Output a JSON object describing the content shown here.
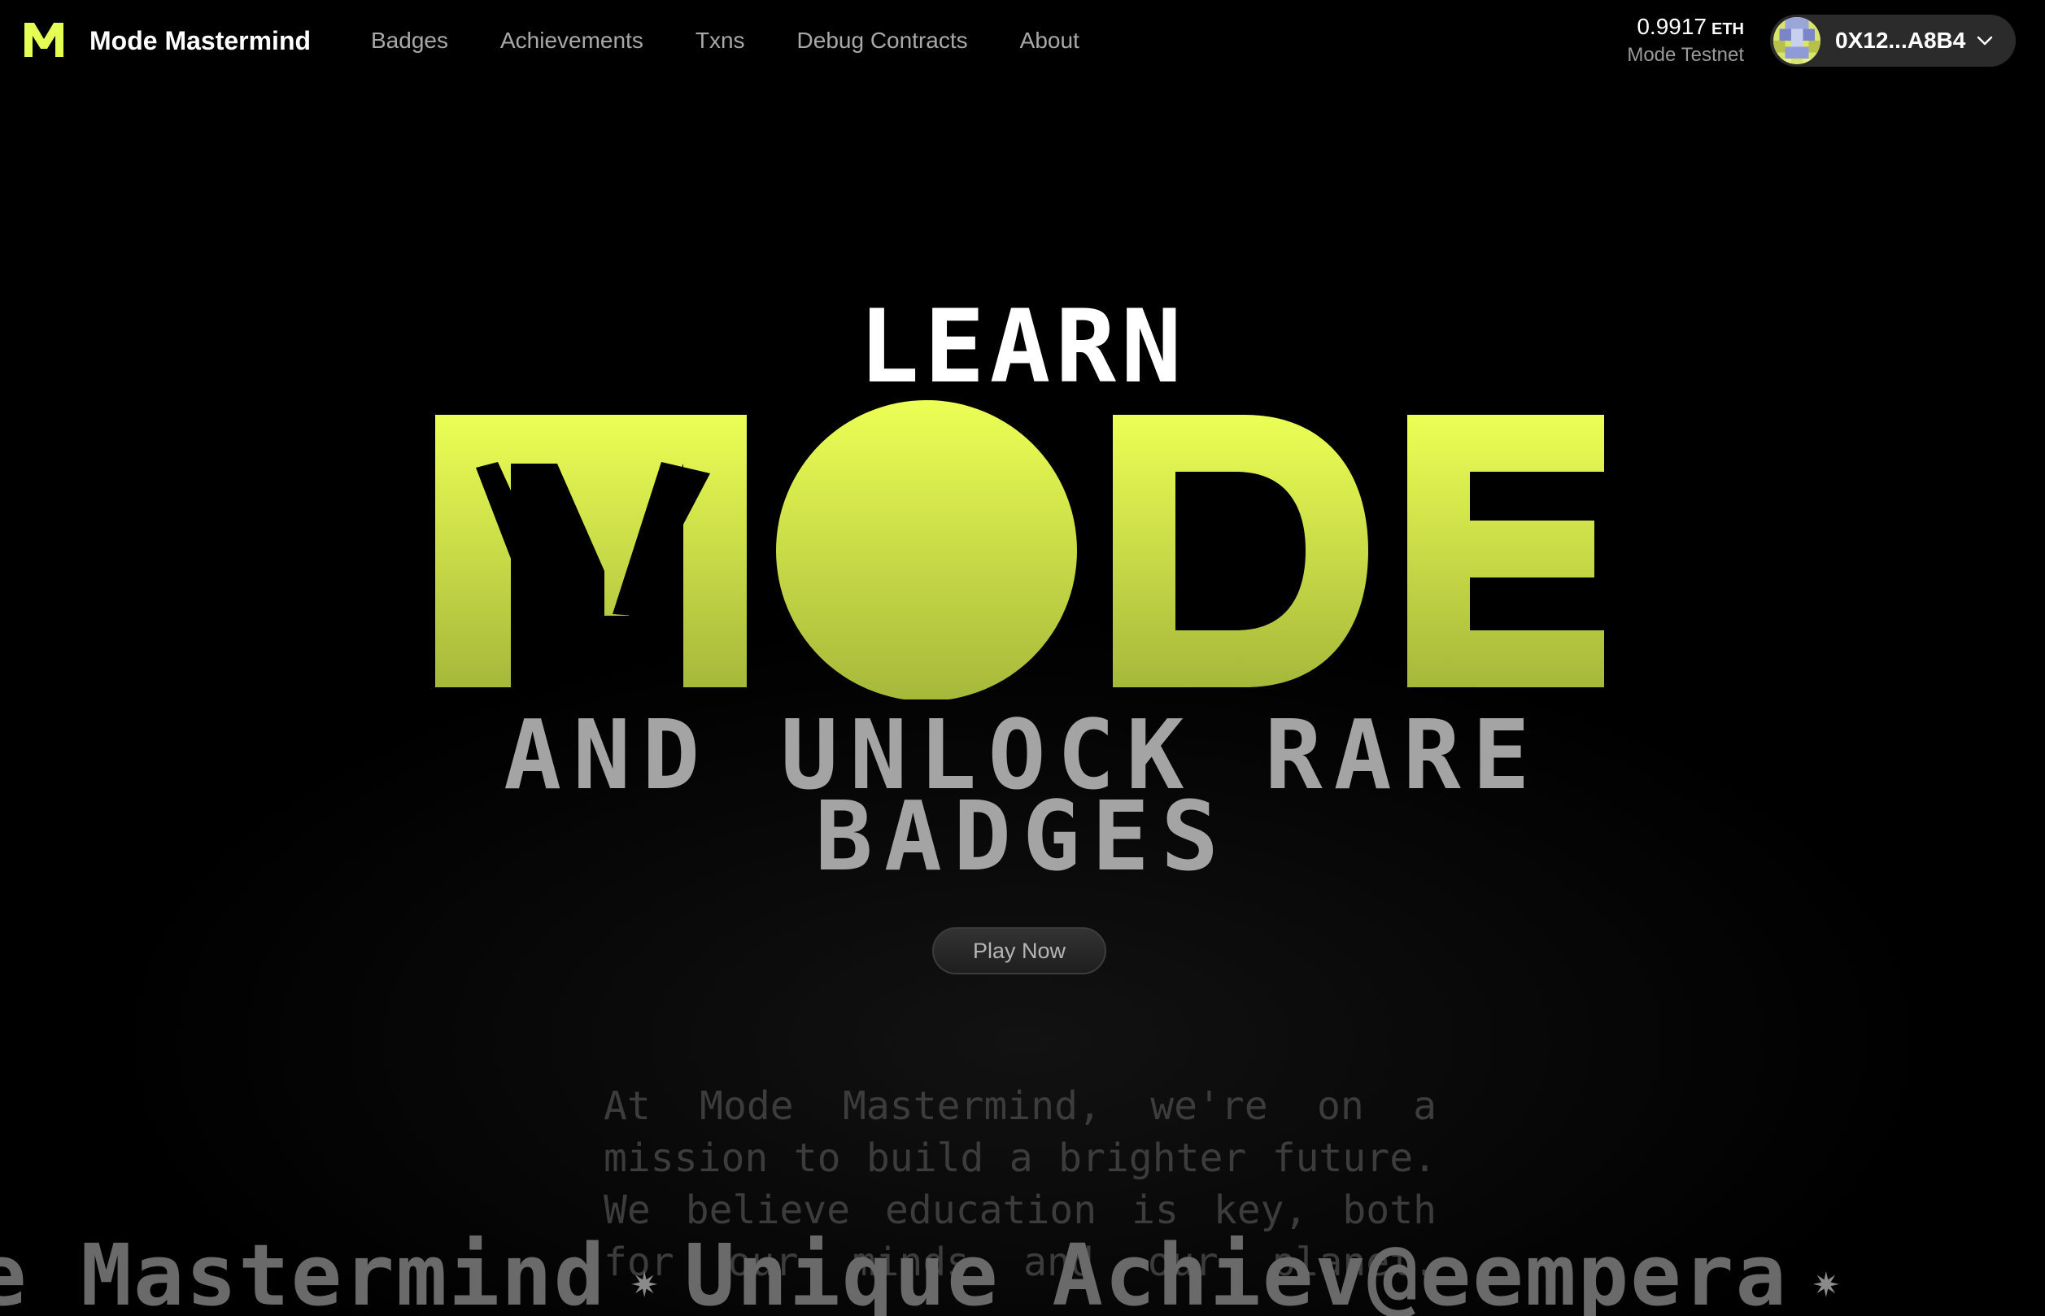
{
  "header": {
    "brand_name": "Mode Mastermind",
    "logo_letter": "M",
    "nav": [
      "Badges",
      "Achievements",
      "Txns",
      "Debug Contracts",
      "About"
    ],
    "balance": {
      "amount": "0.9917",
      "unit": "ETH",
      "network": "Mode Testnet"
    },
    "wallet": {
      "address": "0X12...A8B4",
      "avatar_icon": "pixel-avatar-icon",
      "dropdown_icon": "chevron-down-icon"
    }
  },
  "hero": {
    "line1": "LEARN",
    "line2": "MODE",
    "line3a": "AND UNLOCK RARE",
    "line3b": "BADGES",
    "cta_label": "Play Now"
  },
  "mission": {
    "lines": [
      "At Mode Mastermind, we're on a",
      "mission to build a brighter future.",
      "We believe education is key, both",
      "for our minds and our planet."
    ]
  },
  "ticker": {
    "items": [
      "e Mastermind",
      "Unique",
      "Achiev",
      "@eempera"
    ]
  },
  "colors": {
    "accent": "#e6ff55",
    "accent_dark": "#a9bd3b",
    "background": "#000000",
    "nav_text": "#a8a8a8"
  }
}
